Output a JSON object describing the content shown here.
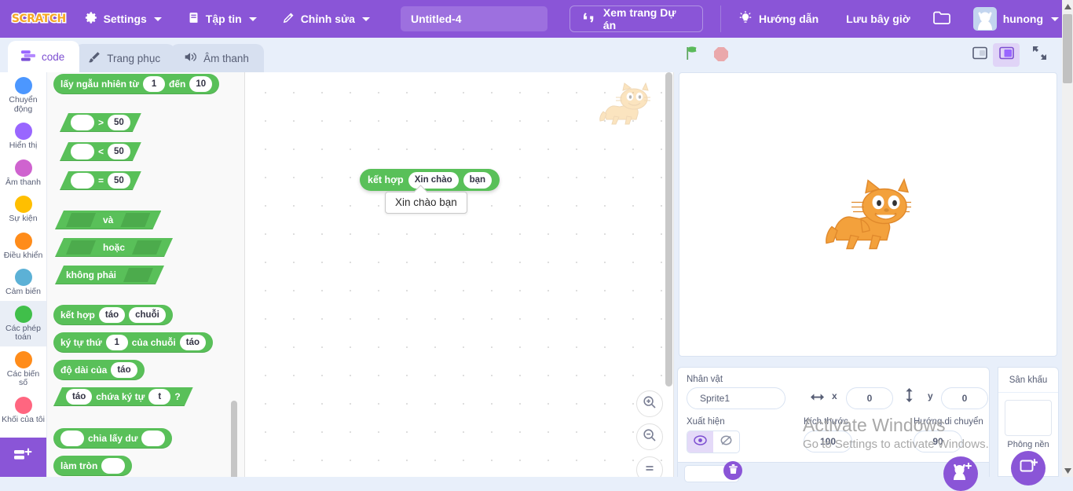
{
  "app": {
    "logo_text": "SCRATCH",
    "project_title": "Untitled-4",
    "colors": {
      "brand_purple": "#8a55d7",
      "block_green": "#59c059",
      "page_blue": "#e8effa",
      "text_gray": "#575e75"
    }
  },
  "menubar": {
    "settings": "Settings",
    "file": "Tập tin",
    "edit": "Chỉnh sửa",
    "view_project": "Xem trang Dự án",
    "tutorials": "Hướng dẫn",
    "save_now": "Lưu bây giờ",
    "username": "hunong",
    "icons": {
      "settings": "gear-icon",
      "file": "file-icon",
      "edit": "pencil-icon",
      "view_project": "quotes-icon",
      "tutorials": "lightbulb-icon",
      "folder": "folder-icon",
      "avatar": "cat-avatar-icon"
    }
  },
  "tabs": [
    {
      "label": "code",
      "icon": "code-blocks-icon",
      "active": true
    },
    {
      "label": "Trang phục",
      "icon": "paintbrush-icon",
      "active": false
    },
    {
      "label": "Âm thanh",
      "icon": "speaker-icon",
      "active": false
    }
  ],
  "stage_controls": {
    "green_flag": "green-flag-icon",
    "stop": "stop-sign-icon",
    "small_stage": "small-stage-icon",
    "large_stage": "large-stage-icon",
    "fullscreen": "fullscreen-icon",
    "selected_layout": "large-stage"
  },
  "categories": [
    {
      "label": "Chuyển động",
      "color": "#4c97ff",
      "selected": false
    },
    {
      "label": "Hiển thị",
      "color": "#9966ff",
      "selected": false
    },
    {
      "label": "Âm thanh",
      "color": "#cf63cf",
      "selected": false
    },
    {
      "label": "Sự kiện",
      "color": "#ffbf00",
      "selected": false
    },
    {
      "label": "Điều khiển",
      "color": "#ff8c1a",
      "selected": false
    },
    {
      "label": "Cảm biến",
      "color": "#5cb1d6",
      "selected": false
    },
    {
      "label": "Các phép toán",
      "color": "#40bf4a",
      "selected": true
    },
    {
      "label": "Các biến số",
      "color": "#ff8c1a",
      "selected": false
    },
    {
      "label": "Khối của tôi",
      "color": "#ff6680",
      "selected": false
    }
  ],
  "add_extension": "add-extension-icon",
  "palette_blocks": {
    "random": {
      "label_a": "lấy ngẫu nhiên từ",
      "val_from": "1",
      "label_b": "đến",
      "val_to": "10"
    },
    "gt": {
      "op": ">",
      "val": "50"
    },
    "lt": {
      "op": "<",
      "val": "50"
    },
    "eq": {
      "op": "=",
      "val": "50"
    },
    "and": {
      "label": "và"
    },
    "or": {
      "label": "hoặc"
    },
    "not": {
      "label": "không phải"
    },
    "join": {
      "label": "kết hợp",
      "a": "táo",
      "b": "chuỗi"
    },
    "letter_of": {
      "label_a": "ký tự thứ",
      "index": "1",
      "label_b": "của chuỗi",
      "str": "táo"
    },
    "length_of": {
      "label": "độ dài của",
      "str": "táo"
    },
    "contains": {
      "str": "táo",
      "label": "chứa ký tự",
      "ch": "t",
      "q": "?"
    },
    "modulo": {
      "label": "chia lấy dư"
    },
    "round": {
      "label": "làm tròn"
    }
  },
  "canvas": {
    "dragged_block": {
      "label": "kết hợp",
      "a": "Xin chào",
      "b": "bạn"
    },
    "tooltip": "Xin chào bạn",
    "zoom_in": "zoom-in-icon",
    "zoom_out": "zoom-out-icon",
    "zoom_reset": "zoom-reset-icon",
    "watermark_sprite": "cat-watermark-icon"
  },
  "sprite_info": {
    "name_label": "Nhân vật",
    "name_value": "Sprite1",
    "x_label": "x",
    "x_value": "0",
    "y_label": "y",
    "y_value": "0",
    "show_label": "Xuất hiện",
    "size_label": "Kích thước",
    "size_value": "100",
    "direction_label": "Hướng di chuyển",
    "direction_value": "90",
    "show_icon": "eye-visible-icon",
    "hide_icon": "eye-hidden-icon",
    "visible_selected": true,
    "x_icon": "horizontal-arrows-icon",
    "y_icon": "vertical-arrows-icon"
  },
  "stage_panel": {
    "title": "Sân khấu",
    "backdrops_label": "Phông nền",
    "add_backdrop_icon": "add-backdrop-icon"
  },
  "sprite_list": {
    "delete_icon": "trash-icon",
    "add_sprite_icon": "add-sprite-icon"
  },
  "watermark": {
    "line1": "Activate Windows",
    "line2": "Go to Settings to activate Windows."
  }
}
